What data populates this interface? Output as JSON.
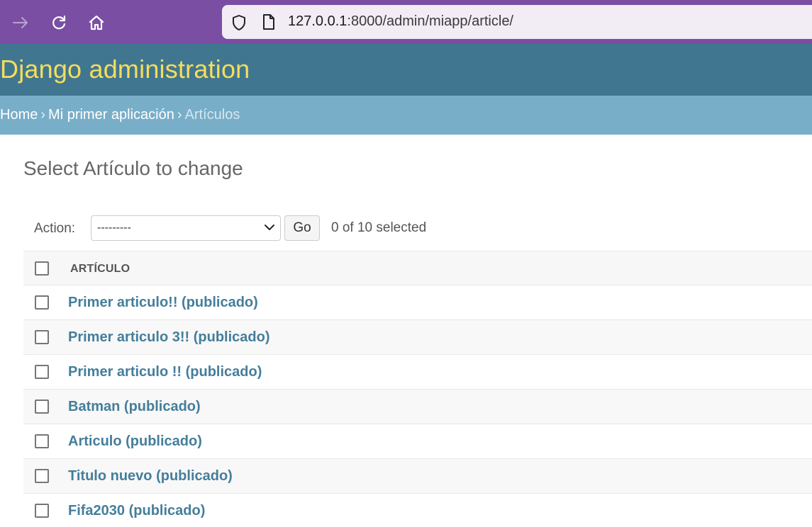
{
  "browser": {
    "url_host": "127.0.0.1",
    "url_rest": ":8000/admin/miapp/article/"
  },
  "header": {
    "title": "Django administration"
  },
  "breadcrumbs": {
    "home": "Home",
    "separator": "›",
    "app": "Mi primer aplicación",
    "current": "Artículos"
  },
  "page": {
    "title": "Select Artículo to change"
  },
  "actions": {
    "label": "Action:",
    "selected_option": "---------",
    "go_label": "Go",
    "counter": "0 of 10 selected"
  },
  "table": {
    "column_header": "ARTÍCULO",
    "rows": [
      "Primer articulo!! (publicado)",
      "Primer articulo 3!! (publicado)",
      "Primer articulo !! (publicado)",
      "Batman (publicado)",
      "Articulo (publicado)",
      "Titulo nuevo (publicado)",
      "Fifa2030 (publicado)"
    ]
  },
  "colors": {
    "browser_bar": "#7a4ea3",
    "header_bg": "#417690",
    "header_title": "#f5dd5d",
    "breadcrumb_bg": "#79aec8",
    "link": "#447e9b"
  },
  "icons": {
    "nav": [
      "forward-arrow-icon",
      "reload-icon",
      "home-icon"
    ],
    "address": [
      "shield-icon",
      "page-icon"
    ]
  }
}
